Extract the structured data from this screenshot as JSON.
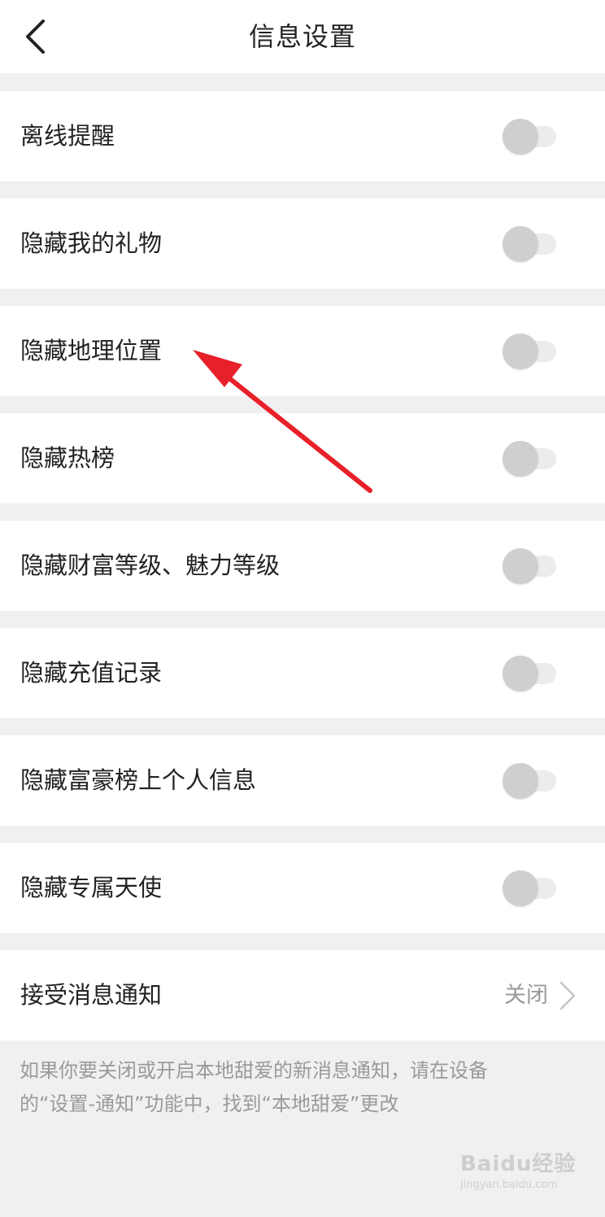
{
  "header": {
    "title": "信息设置",
    "back_icon": "chevron-left-icon"
  },
  "settings": [
    {
      "label": "离线提醒",
      "enabled": false
    },
    {
      "label": "隐藏我的礼物",
      "enabled": false
    },
    {
      "label": "隐藏地理位置",
      "enabled": false
    },
    {
      "label": "隐藏热榜",
      "enabled": false
    },
    {
      "label": "隐藏财富等级、魅力等级",
      "enabled": false
    },
    {
      "label": "隐藏充值记录",
      "enabled": false
    },
    {
      "label": "隐藏富豪榜上个人信息",
      "enabled": false
    },
    {
      "label": "隐藏专属天使",
      "enabled": false
    }
  ],
  "notification": {
    "label": "接受消息通知",
    "value": "关闭",
    "icon": "chevron-right-icon"
  },
  "footer": {
    "note_line1": "如果你要关闭或开启本地甜爱的新消息通知，请在设备",
    "note_line2": "的“设置-通知”功能中，找到“本地甜爱”更改"
  },
  "watermark": {
    "main": "Baidu经验",
    "sub": "jingyan.baidu.com"
  },
  "colors": {
    "page_background": "#f0f0f0",
    "row_background": "#ffffff",
    "toggle_knob_off": "#cfcfcf",
    "toggle_track_off": "#ececec",
    "annotation_arrow": "#e8202a"
  }
}
